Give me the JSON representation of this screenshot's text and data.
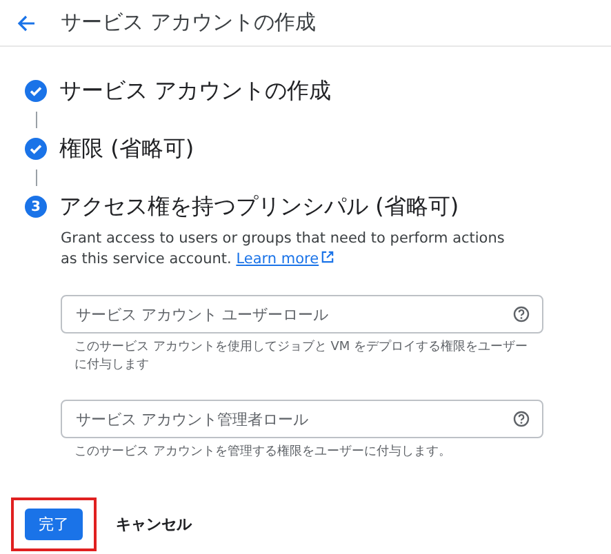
{
  "header": {
    "title": "サービス アカウントの作成"
  },
  "steps": [
    {
      "kind": "done",
      "title": "サービス アカウントの作成"
    },
    {
      "kind": "done",
      "title": "権限 (省略可)"
    },
    {
      "kind": "current",
      "number": "3",
      "title": "アクセス権を持つプリンシパル (省略可)",
      "description": "Grant access to users or groups that need to perform actions as this service account.",
      "link": "Learn more"
    }
  ],
  "fields": [
    {
      "placeholder": "サービス アカウント ユーザーロール",
      "helper": "このサービス アカウントを使用してジョブと VM をデプロイする権限をユーザーに付与します"
    },
    {
      "placeholder": "サービス アカウント管理者ロール",
      "helper": "このサービス アカウントを管理する権限をユーザーに付与します。"
    }
  ],
  "actions": {
    "done": {
      "label": "完了",
      "highlighted": true
    },
    "cancel": {
      "label": "キャンセル"
    }
  }
}
